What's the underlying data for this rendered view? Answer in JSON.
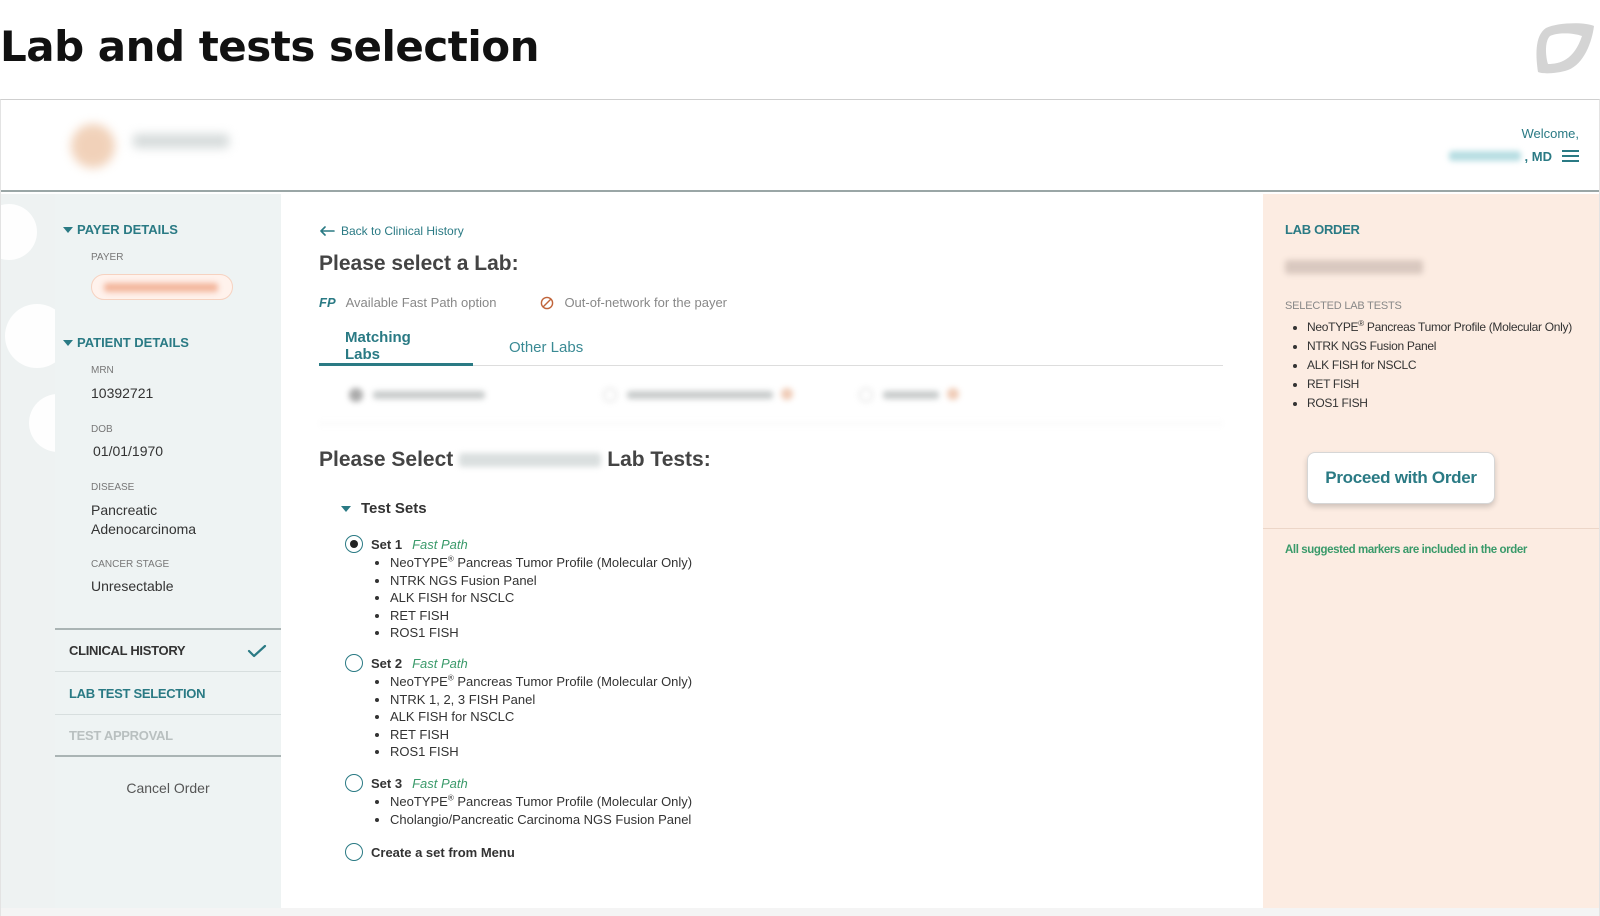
{
  "page": {
    "heading": "Lab and tests selection"
  },
  "header": {
    "welcome": "Welcome,",
    "user_suffix": ", MD"
  },
  "sidebar": {
    "payer_details": {
      "title": "PAYER DETAILS",
      "payer_label": "PAYER"
    },
    "patient_details": {
      "title": "PATIENT DETAILS",
      "mrn_label": "MRN",
      "mrn": "10392721",
      "dob_label": "DOB",
      "dob": "01/01/1970",
      "disease_label": "DISEASE",
      "disease_line1": "Pancreatic",
      "disease_line2": "Adenocarcinoma",
      "stage_label": "CANCER STAGE",
      "stage": "Unresectable"
    },
    "nav": [
      {
        "label": "CLINICAL HISTORY",
        "state": "completed"
      },
      {
        "label": "LAB TEST SELECTION",
        "state": "active"
      },
      {
        "label": "TEST APPROVAL",
        "state": "disabled"
      }
    ],
    "cancel_label": "Cancel Order"
  },
  "main": {
    "back_label": "Back to Clinical History",
    "title": "Please select a Lab:",
    "legend": {
      "fp_badge": "FP",
      "fp_text": "Available Fast Path option",
      "oon_text": "Out-of-network for the payer"
    },
    "tabs": [
      {
        "label": "Matching Labs",
        "active": true
      },
      {
        "label": "Other Labs",
        "active": false
      }
    ],
    "select_prefix": "Please Select",
    "select_suffix": "Lab Tests:",
    "test_sets_label": "Test Sets",
    "sets": [
      {
        "label": "Set 1",
        "tag": "Fast Path",
        "selected": true,
        "items": [
          {
            "name": "NeoTYPE",
            "sup": "®",
            "rest": " Pancreas Tumor Profile (Molecular Only)"
          },
          {
            "name": "NTRK NGS Fusion Panel",
            "sup": "",
            "rest": ""
          },
          {
            "name": "ALK FISH for NSCLC",
            "sup": "",
            "rest": ""
          },
          {
            "name": "RET FISH",
            "sup": "",
            "rest": ""
          },
          {
            "name": "ROS1 FISH",
            "sup": "",
            "rest": ""
          }
        ]
      },
      {
        "label": "Set 2",
        "tag": "Fast Path",
        "selected": false,
        "items": [
          {
            "name": "NeoTYPE",
            "sup": "®",
            "rest": " Pancreas Tumor Profile (Molecular Only)"
          },
          {
            "name": "NTRK 1, 2, 3 FISH Panel",
            "sup": "",
            "rest": ""
          },
          {
            "name": "ALK FISH for NSCLC",
            "sup": "",
            "rest": ""
          },
          {
            "name": "RET FISH",
            "sup": "",
            "rest": ""
          },
          {
            "name": "ROS1 FISH",
            "sup": "",
            "rest": ""
          }
        ]
      },
      {
        "label": "Set 3",
        "tag": "Fast Path",
        "selected": false,
        "items": [
          {
            "name": "NeoTYPE",
            "sup": "®",
            "rest": " Pancreas Tumor Profile (Molecular Only)"
          },
          {
            "name": "Cholangio/Pancreatic Carcinoma NGS Fusion Panel",
            "sup": "",
            "rest": ""
          }
        ]
      }
    ],
    "create_set_label": "Create a set from Menu"
  },
  "order_panel": {
    "title": "LAB ORDER",
    "selected_label": "SELECTED LAB TESTS",
    "tests": [
      {
        "name": "NeoTYPE",
        "sup": "®",
        "rest": " Pancreas Tumor Profile (Molecular Only)"
      },
      {
        "name": "NTRK NGS Fusion Panel",
        "sup": "",
        "rest": ""
      },
      {
        "name": "ALK FISH for NSCLC",
        "sup": "",
        "rest": ""
      },
      {
        "name": "RET FISH",
        "sup": "",
        "rest": ""
      },
      {
        "name": "ROS1 FISH",
        "sup": "",
        "rest": ""
      }
    ],
    "proceed_label": "Proceed with Order",
    "note": "All suggested markers are included in the order"
  },
  "colors": {
    "accent": "#2a7a84",
    "fast_path": "#3a9a6a",
    "order_panel_bg": "#fcece2",
    "sidebar_bg": "#eef3f3"
  },
  "icons": [
    "corner-logo-icon",
    "menu-icon",
    "caret-down-icon",
    "check-icon",
    "back-arrow-icon",
    "out-of-network-icon",
    "radio-icon"
  ]
}
